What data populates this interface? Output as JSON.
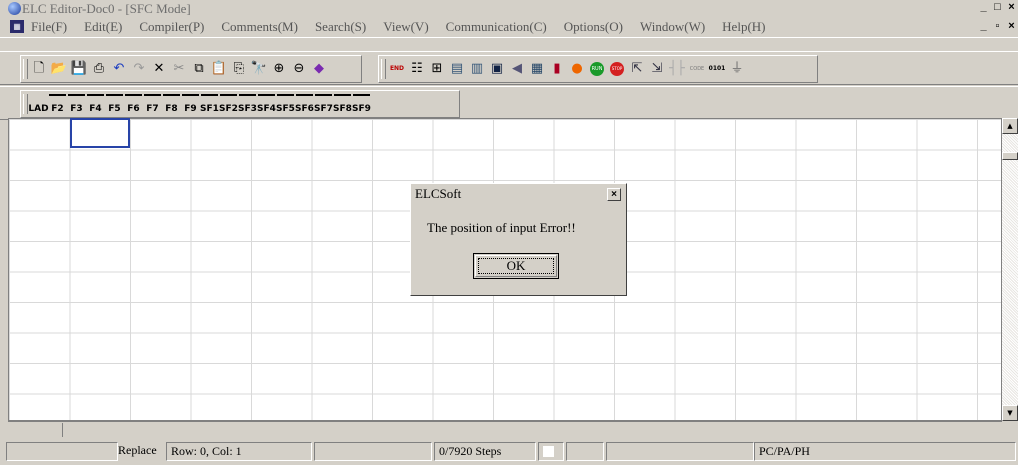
{
  "window": {
    "title": "ELC Editor-Doc0 - [SFC Mode]",
    "controls": [
      "_",
      "□",
      "×"
    ],
    "mdi_controls": [
      "_",
      "▫",
      "×"
    ]
  },
  "menu": {
    "items": [
      "File(F)",
      "Edit(E)",
      "Compiler(P)",
      "Comments(M)",
      "Search(S)",
      "View(V)",
      "Communication(C)",
      "Options(O)",
      "Window(W)",
      "Help(H)"
    ]
  },
  "toolbar_sfc": {
    "keys": [
      "LAD",
      "F2",
      "F3",
      "F4",
      "F5",
      "F6",
      "F7",
      "F8",
      "F9",
      "SF1",
      "SF2",
      "SF3",
      "SF4",
      "SF5",
      "SF6",
      "SF7",
      "SF8",
      "SF9"
    ]
  },
  "toolbar_main": {
    "icons": [
      "new-icon",
      "open-icon",
      "save-icon",
      "print-icon",
      "undo-icon",
      "redo-icon",
      "delete-icon",
      "cut-icon",
      "copy-icon",
      "paste-icon",
      "clipboard-icon",
      "find-icon",
      "zoom-in-icon",
      "zoom-out-icon",
      "compile-icon"
    ],
    "plc_icons": [
      "sort-end-icon",
      "ladder-icon",
      "diagram-icon",
      "monitor-icon",
      "table-icon",
      "device-icon",
      "arrow-left-icon",
      "register-icon",
      "relay-icon",
      "on-line-icon",
      "run-icon",
      "stop-icon",
      "read-icon",
      "write-icon",
      "contact-icon",
      "coil-icon",
      "code-icon",
      "block-icon"
    ],
    "labels": {
      "plc_end": "END",
      "run": "RUN",
      "stop": "STOP",
      "code": "CODE",
      "binary": "0101"
    }
  },
  "dialog": {
    "title": "ELCSoft",
    "message": "The position of input Error!!",
    "ok_label": "OK",
    "close_glyph": "×"
  },
  "statusbar": {
    "mode": "Replace",
    "position": "Row: 0, Col: 1",
    "steps": "0/7920 Steps",
    "plc_model": "PC/PA/PH"
  },
  "colors": {
    "cursor_cell": "#2844a8",
    "title_text": "#6e6e6e"
  }
}
